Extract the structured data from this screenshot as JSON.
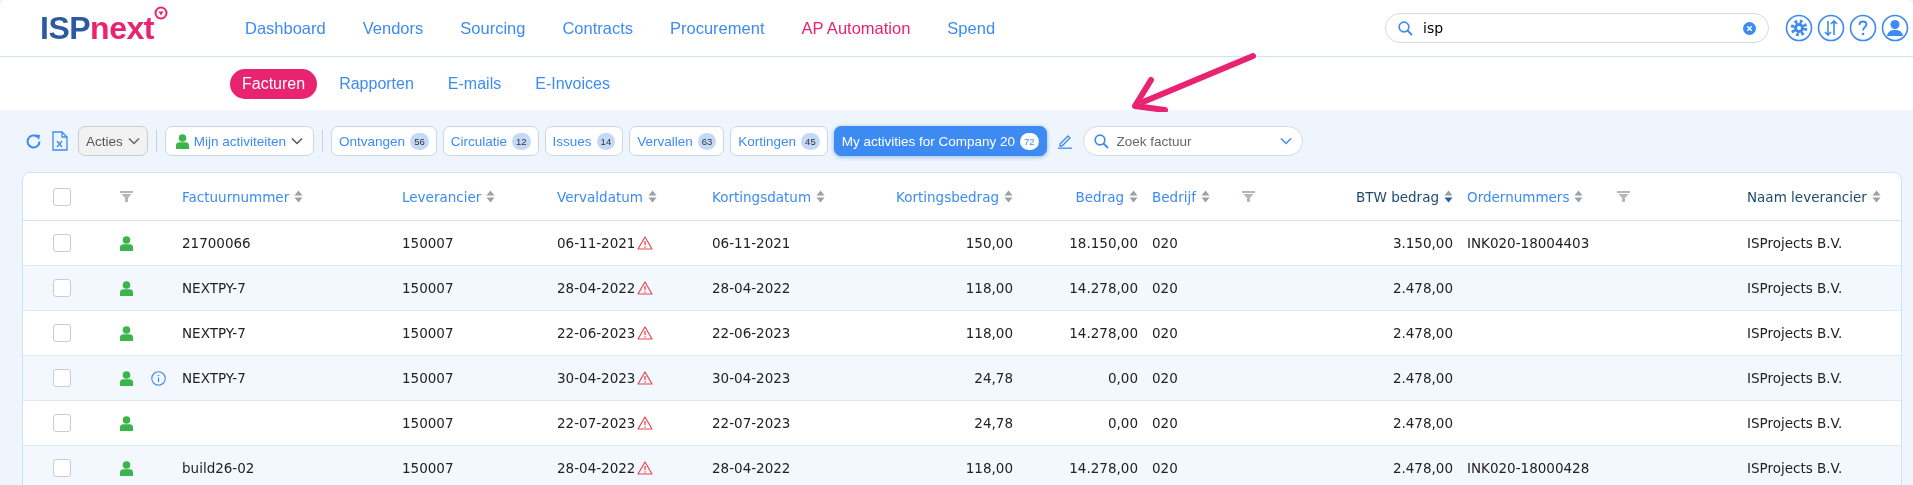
{
  "header": {
    "logo": {
      "prefix": "ISP",
      "suffix": "next"
    },
    "nav": [
      {
        "label": "Dashboard",
        "selected": false
      },
      {
        "label": "Vendors",
        "selected": false
      },
      {
        "label": "Sourcing",
        "selected": false
      },
      {
        "label": "Contracts",
        "selected": false
      },
      {
        "label": "Procurement",
        "selected": false
      },
      {
        "label": "AP Automation",
        "selected": true
      },
      {
        "label": "Spend",
        "selected": false
      }
    ],
    "search": {
      "value": "isp"
    }
  },
  "subnav": [
    {
      "label": "Facturen",
      "selected": true
    },
    {
      "label": "Rapporten",
      "selected": false
    },
    {
      "label": "E-mails",
      "selected": false
    },
    {
      "label": "E-Invoices",
      "selected": false
    }
  ],
  "toolbar": {
    "actions_label": "Acties",
    "activity_label": "Mijn activiteiten",
    "filters": [
      {
        "label": "Ontvangen",
        "count": "56",
        "selected": false
      },
      {
        "label": "Circulatie",
        "count": "12",
        "selected": false
      },
      {
        "label": "Issues",
        "count": "14",
        "selected": false
      },
      {
        "label": "Vervallen",
        "count": "63",
        "selected": false
      },
      {
        "label": "Kortingen",
        "count": "45",
        "selected": false
      },
      {
        "label": "My activities for Company 20",
        "count": "72",
        "selected": true
      }
    ],
    "search": {
      "placeholder": "Zoek factuur"
    }
  },
  "table": {
    "all_checked": false,
    "columns": [
      {
        "label": "Factuurnummer",
        "kind": "link",
        "sorted": false
      },
      {
        "label": "Leverancier",
        "kind": "link",
        "sorted": false
      },
      {
        "label": "Vervaldatum",
        "kind": "link",
        "sorted": false
      },
      {
        "label": "Kortingsdatum",
        "kind": "link",
        "sorted": false
      },
      {
        "label": "Kortingsbedrag",
        "kind": "link",
        "sorted": false
      },
      {
        "label": "Bedrag",
        "kind": "link",
        "sorted": false
      },
      {
        "label": "Bedrijf",
        "kind": "link",
        "sorted": false
      },
      {
        "label": "BTW bedrag",
        "kind": "plain",
        "sorted": true
      },
      {
        "label": "Ordernummers",
        "kind": "link",
        "sorted": false
      },
      {
        "label": "Naam leverancier",
        "kind": "plain",
        "sorted": false
      }
    ],
    "rows": [
      {
        "checked": false,
        "assigned": true,
        "info": false,
        "factuurnummer": "21700066",
        "leverancier": "150007",
        "vervaldatum": "06-11-2021",
        "overdue": true,
        "kortingsdatum": "06-11-2021",
        "kortingsbedrag": "150,00",
        "bedrag": "18.150,00",
        "bedrijf": "020",
        "btw_bedrag": "3.150,00",
        "ordernummer": "INK020-18004403",
        "naam_leverancier": "ISProjects B.V."
      },
      {
        "checked": false,
        "assigned": true,
        "info": false,
        "factuurnummer": "NEXTPY-7",
        "leverancier": "150007",
        "vervaldatum": "28-04-2022",
        "overdue": true,
        "kortingsdatum": "28-04-2022",
        "kortingsbedrag": "118,00",
        "bedrag": "14.278,00",
        "bedrijf": "020",
        "btw_bedrag": "2.478,00",
        "naam_leverancier": "ISProjects B.V."
      },
      {
        "checked": false,
        "assigned": true,
        "info": false,
        "factuurnummer": "NEXTPY-7",
        "leverancier": "150007",
        "vervaldatum": "22-06-2023",
        "overdue": true,
        "kortingsdatum": "22-06-2023",
        "kortingsbedrag": "118,00",
        "bedrag": "14.278,00",
        "bedrijf": "020",
        "btw_bedrag": "2.478,00",
        "naam_leverancier": "ISProjects B.V."
      },
      {
        "checked": false,
        "assigned": true,
        "info": true,
        "factuurnummer": "NEXTPY-7",
        "leverancier": "150007",
        "vervaldatum": "30-04-2023",
        "overdue": true,
        "kortingsdatum": "30-04-2023",
        "kortingsbedrag": "24,78",
        "bedrag": "0,00",
        "bedrijf": "020",
        "btw_bedrag": "2.478,00",
        "naam_leverancier": "ISProjects B.V."
      },
      {
        "checked": false,
        "assigned": true,
        "info": false,
        "leverancier": "150007",
        "vervaldatum": "22-07-2023",
        "overdue": true,
        "kortingsdatum": "22-07-2023",
        "kortingsbedrag": "24,78",
        "bedrag": "0,00",
        "bedrijf": "020",
        "btw_bedrag": "2.478,00",
        "naam_leverancier": "ISProjects B.V."
      },
      {
        "checked": false,
        "assigned": true,
        "info": false,
        "factuurnummer": "build26-02",
        "leverancier": "150007",
        "vervaldatum": "28-04-2022",
        "overdue": true,
        "kortingsdatum": "28-04-2022",
        "kortingsbedrag": "118,00",
        "bedrag": "14.278,00",
        "bedrijf": "020",
        "btw_bedrag": "2.478,00",
        "ordernummer": "INK020-18000428",
        "naam_leverancier": "ISProjects B.V."
      }
    ]
  }
}
